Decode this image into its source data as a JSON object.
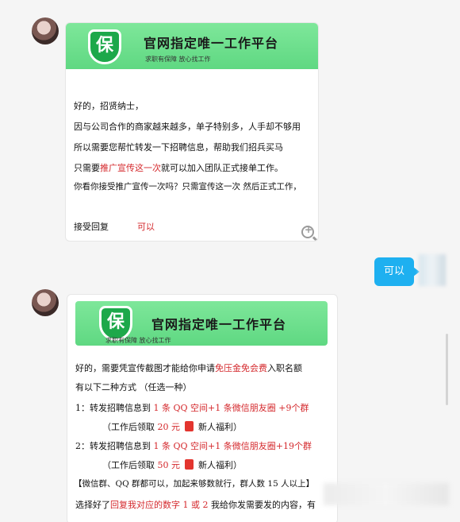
{
  "card1": {
    "banner_title": "官网指定唯一工作平台",
    "banner_sub": "求职有保障  放心找工作",
    "shield": "保",
    "lines": [
      "好的，招贤纳士，",
      "因与公司合作的商家越来越多，单子特别多，人手却不够用",
      "所以需要您帮忙转发一下招聘信息，帮助我们招兵买马"
    ],
    "line4_pre": "只需要",
    "line4_red": "推广宣传这一次",
    "line4_post": "就可以加入团队正式接单工作。",
    "line5": "你看你接受推广宣传一次吗？只需宣传这一次  然后正式工作，",
    "reply_label": "接受回复",
    "reply_value": "可以"
  },
  "bubble": "可以",
  "card2": {
    "banner_title": "官网指定唯一工作平台",
    "banner_sub": "求职有保障  放心找工作",
    "shield": "保",
    "l1_pre": "好的，需要凭宣传截图才能给你申请",
    "l1_red": "免压金免会费",
    "l1_post": "入职名额",
    "l2": "有以下二种方式 （任选一种）",
    "l3_pre": "1：转发招聘信息到 ",
    "l3_red": "1 条 QQ 空间+1 条微信朋友圈 +9个群",
    "l4_pre": "（工作后领取 ",
    "l4_red": "20 元",
    "l4_post": "新人福利）",
    "l5_pre": "2：转发招聘信息到 ",
    "l5_red": "1 条 QQ 空间+1 条微信朋友圈+19个群",
    "l6_pre": "（工作后领取 ",
    "l6_red": "50 元",
    "l6_post": "新人福利）",
    "l7": "【微信群、QQ 群都可以，加起来够数就行，群人数 15 人以上】",
    "l8_pre": "选择好了",
    "l8_red": "回复我对应的数字 1 或 2",
    "l8_post": "  我给你发需要发的内容，有"
  }
}
